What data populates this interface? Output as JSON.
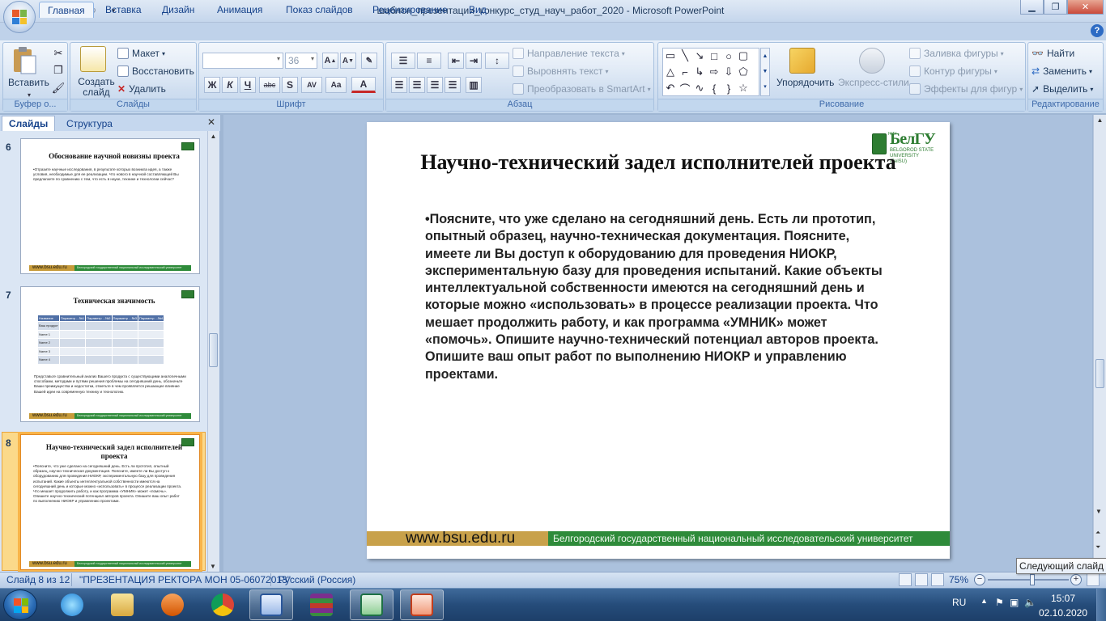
{
  "window": {
    "title": "шаблон_презентации_конкурс_студ_науч_работ_2020 - Microsoft PowerPoint",
    "minimize_icon": "minimize-icon",
    "maximize_icon": "restore-icon",
    "close_icon": "close-icon"
  },
  "tabs": [
    "Главная",
    "Вставка",
    "Дизайн",
    "Анимация",
    "Показ слайдов",
    "Рецензирование",
    "Вид"
  ],
  "ribbon": {
    "clipboard": {
      "label": "Буфер о...",
      "paste": "Вставить"
    },
    "slides": {
      "label": "Слайды",
      "new_slide": "Создать слайд",
      "layout": "Макет",
      "reset": "Восстановить",
      "delete": "Удалить"
    },
    "font": {
      "label": "Шрифт",
      "font_name": "",
      "font_size": "36",
      "bold": "Ж",
      "italic": "К",
      "underline": "Ч",
      "strike": "abc",
      "shadow": "S",
      "spacing": "AV",
      "case": "Aa",
      "color": "A"
    },
    "paragraph": {
      "label": "Абзац",
      "text_direction": "Направление текста",
      "align_text": "Выровнять текст",
      "convert_smartart": "Преобразовать в SmartArt"
    },
    "drawing": {
      "label": "Рисование",
      "arrange": "Упорядочить",
      "quick_styles": "Экспресс-стили",
      "fill": "Заливка фигуры",
      "outline": "Контур фигуры",
      "effects": "Эффекты для фигур"
    },
    "editing": {
      "label": "Редактирование",
      "find": "Найти",
      "replace": "Заменить",
      "select": "Выделить"
    }
  },
  "left_pane": {
    "tabs": [
      "Слайды",
      "Структура"
    ],
    "slides": [
      {
        "num": "6",
        "title": "Обоснование научной новизны проекта",
        "body": "•Отразите научные исследования, в результате которых возникла идея, а также условия, необходимые для ее реализации. Что нового в научной составляющей Вы предлагаете по сравнению с тем, что есть в науке, технике и технологии сейчас?",
        "url": "www.bsu.edu.ru",
        "org": "Белгородский государственный национальный исследовательский университет"
      },
      {
        "num": "7",
        "title": "Техническая значимость",
        "table_header": [
          "Название",
          "Параметр ...№1",
          "Параметр ...№2",
          "Параметр ...№3",
          "Параметр ...№4"
        ],
        "table_rows": [
          "Ваш продукт",
          "Name 1",
          "Name 2",
          "Name 3",
          "Name 4"
        ],
        "body": "Представьте сравнительный анализ Вашего продукта с существующими аналогичными способами, методами и путями решения проблемы на сегодняшний день, обозначьте Ваши преимущества и недостатки, отметьте в чем проявляется решающее влияние Вашей идеи на современную технику и технологию.",
        "url": "www.bsu.edu.ru",
        "org": "Белгородский государственный национальный исследовательский университет"
      },
      {
        "num": "8",
        "title": "Научно-технический задел исполнителей проекта",
        "body": "•Поясните, что уже сделано на сегодняшний день. Есть ли прототип, опытный образец, научно-техническая документация. Поясните, имеете ли Вы доступ к оборудованию для проведения НИОКР, экспериментальную базу для проведения испытаний. Какие объекты интеллектуальной собственности имеются на сегодняшний день и которые можно «использовать» в процессе реализации проекта. Что мешает продолжить работу, и как программа «УМНИК» может «помочь». Опишите научно-технический потенциал авторов проекта. Опишите ваш опыт работ по выполнению НИОКР и управлению проектами.",
        "url": "www.bsu.edu.ru",
        "org": "Белгородский государственный национальный исследовательский университет"
      }
    ]
  },
  "slide": {
    "title": "Научно-технический задел исполнителей проекта",
    "body": "•Поясните, что уже сделано на сегодняшний день. Есть ли прототип, опытный образец, научно-техническая документация. Поясните, имеете ли Вы доступ к оборудованию для проведения НИОКР, экспериментальную базу для проведения испытаний. Какие  объекты интеллектуальной собственности  имеются на сегодняшний день и которые можно «использовать» в процессе реализации проекта. Что мешает продолжить работу, и как программа «УМНИК» может «помочь». Опишите научно-технический потенциал авторов проекта. Опишите ваш опыт работ по выполнению НИОКР и управлению проектами.",
    "logo": {
      "niu": "НИУ",
      "name": "БелГУ",
      "sub1": "BELGOROD STATE",
      "sub2": "UNIVERSITY (BelSU)"
    },
    "footer_url": "www.bsu.edu.ru",
    "footer_org": "Белгородский государственный национальный исследовательский университет"
  },
  "tooltip": "Следующий слайд",
  "status": {
    "slide_info": "Слайд 8 из 12",
    "theme": "\"ПРЕЗЕНТАЦИЯ РЕКТОРА МОН 05-06072013\"",
    "language": "Русский (Россия)",
    "zoom": "75%",
    "zoom_fraction": 0.55
  },
  "taskbar": {
    "apps": [
      "internet-explorer-icon",
      "file-explorer-icon",
      "media-player-icon",
      "chrome-icon",
      "word-icon",
      "winrar-icon",
      "excel-icon",
      "powerpoint-icon"
    ],
    "lang": "RU",
    "time": "15:07",
    "date": "02.10.2020"
  },
  "colors": {
    "brand_green": "#2e8b3a",
    "brand_gold": "#c8a14a",
    "ribbon_blue": "#c2d5ec"
  }
}
